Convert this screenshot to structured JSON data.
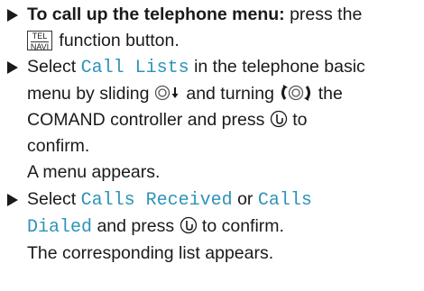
{
  "steps": [
    {
      "bold_lead": "To call up the telephone menu:",
      "text_a": "press the",
      "key_top": "TEL",
      "key_bottom": "NAVI",
      "text_b": "function button."
    },
    {
      "text_a": "Select",
      "item": "Call Lists",
      "text_b": "in the telephone basic",
      "text_c": "menu by sliding",
      "text_d": "and turning",
      "text_e": "the",
      "text_f": "COMAND controller and press",
      "text_g": "to",
      "text_h": "confirm.",
      "result": "A menu appears."
    },
    {
      "text_a": "Select",
      "item_a_line1": "Calls Received",
      "text_or": "or",
      "item_b_line1": "Calls",
      "item_b_line2": "Dialed",
      "text_b": "and press",
      "text_c": "to confirm.",
      "result": "The corresponding list appears."
    }
  ],
  "colors": {
    "highlight": "#2e93b8",
    "text": "#1a1a1a"
  },
  "icons": [
    "controller-slide-down-icon",
    "controller-turn-icon",
    "controller-press-icon"
  ]
}
